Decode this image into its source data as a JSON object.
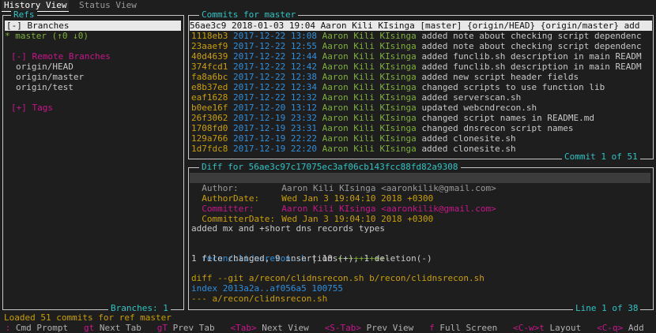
{
  "tabs": [
    {
      "label": "History View"
    },
    {
      "label": "Status View"
    }
  ],
  "refs": {
    "title": "Refs",
    "branches_header": "[-] Branches",
    "local_branch": "* master (↑0 ↓0)",
    "remote_header": "[-] Remote Branches",
    "remotes": [
      "origin/HEAD",
      "origin/master",
      "origin/test"
    ],
    "tags_header": "[+] Tags",
    "footer": "Branches: 1"
  },
  "commits": {
    "title": "Commits for master",
    "footer": "Commit 1 of 51",
    "selected": "56ae3c9 2018-01-03 19:04 Aaron Kili KIsinga [master] {origin/HEAD} {origin/master} add",
    "rows": [
      {
        "hash": "1118eb3",
        "date": "2017-12-22",
        "time": "13:08",
        "author": "Aaron Kili KIsinga",
        "msg": "added note about checking script dependenc"
      },
      {
        "hash": "23aaef9",
        "date": "2017-12-22",
        "time": "12:55",
        "author": "Aaron Kili KIsinga",
        "msg": "added note about checking script dependenc"
      },
      {
        "hash": "40d4639",
        "date": "2017-12-22",
        "time": "12:44",
        "author": "Aaron Kili KIsinga",
        "msg": "added funclib.sh description in main READM"
      },
      {
        "hash": "374fcd1",
        "date": "2017-12-22",
        "time": "12:42",
        "author": "Aaron Kili KIsinga",
        "msg": "added funclib.sh description in main READM"
      },
      {
        "hash": "fa8a6bc",
        "date": "2017-12-22",
        "time": "12:38",
        "author": "Aaron Kili KIsinga",
        "msg": "added new script header fields"
      },
      {
        "hash": "e8b37ed",
        "date": "2017-12-22",
        "time": "12:34",
        "author": "Aaron Kili KIsinga",
        "msg": "changed scripts to use function lib"
      },
      {
        "hash": "eaf1628",
        "date": "2017-12-22",
        "time": "12:32",
        "author": "Aaron Kili KIsinga",
        "msg": "added serverscan.sh"
      },
      {
        "hash": "b0ee16f",
        "date": "2017-12-20",
        "time": "13:12",
        "author": "Aaron Kili KIsinga",
        "msg": "updated webcndrecon.sh"
      },
      {
        "hash": "26f3062",
        "date": "2017-12-19",
        "time": "23:32",
        "author": "Aaron Kili KIsinga",
        "msg": "changed script names in README.md"
      },
      {
        "hash": "1708fd0",
        "date": "2017-12-19",
        "time": "23:31",
        "author": "Aaron Kili KIsinga",
        "msg": "changed dnsrecon script names"
      },
      {
        "hash": "129a766",
        "date": "2017-12-19",
        "time": "22:22",
        "author": "Aaron Kili KIsinga",
        "msg": "added clonesite.sh"
      },
      {
        "hash": "1d7fdc8",
        "date": "2017-12-19",
        "time": "22:20",
        "author": "Aaron Kili KIsinga",
        "msg": "added clonesite.sh"
      }
    ]
  },
  "diff": {
    "title": "Diff for 56ae3c97c17075ec3af06cb143fcc88fd82a9308",
    "footer": "Line 1 of 38",
    "author_label": "Author:",
    "author_value": "Aaron Kili KIsinga <aaronkilik@gmail.com>",
    "authordate_label": "AuthorDate:",
    "authordate_value": "Wed Jan 3 19:04:10 2018 +0300",
    "committer_label": "Committer:",
    "committer_value": "Aaron Kili KIsinga <aaronkilik@gmail.com>",
    "commitdate_label": "CommitterDate:",
    "commitdate_value": "Wed Jan 3 19:04:10 2018 +0300",
    "message": "added mx and +short dns records types",
    "stat_file": "recon/clidnsrecon.sh",
    "stat_sep": " | 10 ",
    "stat_bar": "+++++++++-",
    "summary": "1 file changed, 9 insertions(+), 1 deletion(-)",
    "diff_header": "diff --git a/recon/clidnsrecon.sh b/recon/clidnsrecon.sh",
    "index_line": "index 2013a2a..af056a5 100755",
    "minus_line": "--- a/recon/clidnsrecon.sh"
  },
  "status_message": "Loaded 51 commits for ref master",
  "keybindings": [
    {
      "key": ":",
      "desc": "Cmd Prompt"
    },
    {
      "key": "gt",
      "desc": "Next Tab"
    },
    {
      "key": "gT",
      "desc": "Prev Tab"
    },
    {
      "key": "<Tab>",
      "desc": "Next View"
    },
    {
      "key": "<S-Tab>",
      "desc": "Prev View"
    },
    {
      "key": "f",
      "desc": "Full Screen"
    },
    {
      "key": "<C-w>t",
      "desc": "Layout"
    },
    {
      "key": "<C-q>",
      "desc": "Add"
    }
  ]
}
